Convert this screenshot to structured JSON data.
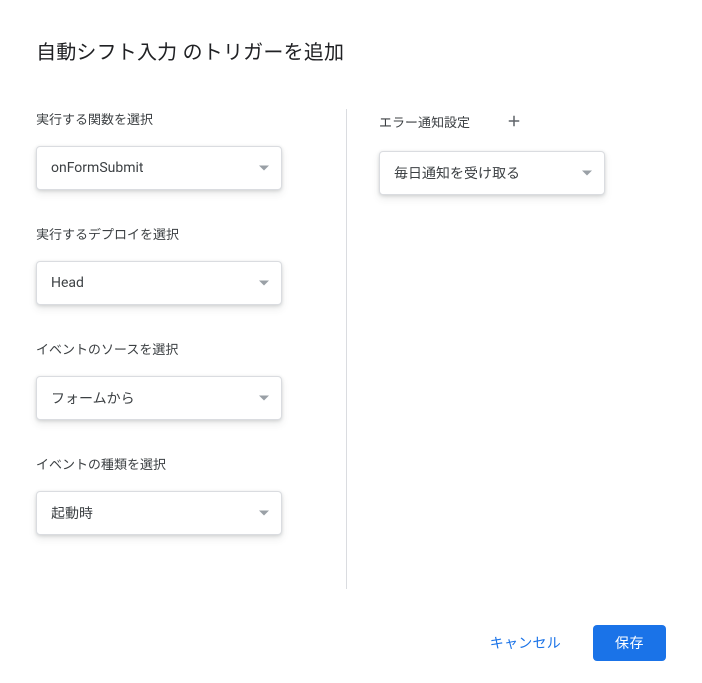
{
  "dialog": {
    "title": "自動シフト入力 のトリガーを追加"
  },
  "left": {
    "function_label": "実行する関数を選択",
    "function_value": "onFormSubmit",
    "deploy_label": "実行するデプロイを選択",
    "deploy_value": "Head",
    "source_label": "イベントのソースを選択",
    "source_value": "フォームから",
    "eventtype_label": "イベントの種類を選択",
    "eventtype_value": "起動時"
  },
  "right": {
    "error_label": "エラー通知設定",
    "error_value": "毎日通知を受け取る"
  },
  "footer": {
    "cancel": "キャンセル",
    "save": "保存"
  }
}
